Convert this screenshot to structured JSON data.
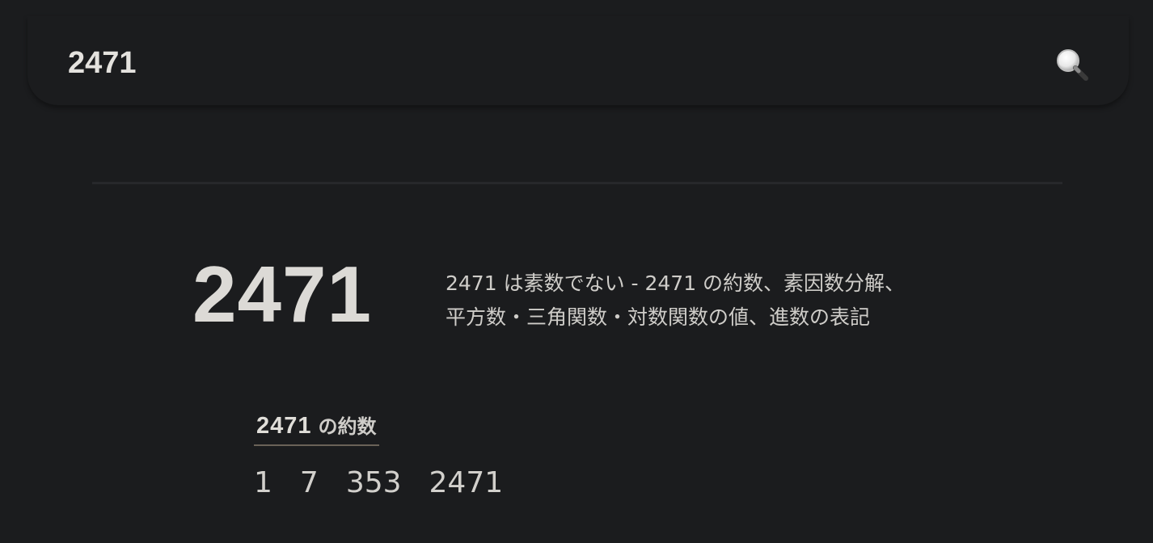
{
  "search": {
    "query": "2471",
    "icon": "search-icon"
  },
  "hero": {
    "number": "2471",
    "description_line1": "2471 は素数でない - 2471 の約数、素因数分解、",
    "description_line2": "平方数・三角関数・対数関数の値、進数の表記"
  },
  "divisors": {
    "heading_number": "2471",
    "heading_label": "の約数",
    "items": [
      "1",
      "7",
      "353",
      "2471"
    ]
  },
  "colors": {
    "background": "#1b1c1e",
    "text": "#d8d6d2",
    "underline": "#6a6258"
  }
}
